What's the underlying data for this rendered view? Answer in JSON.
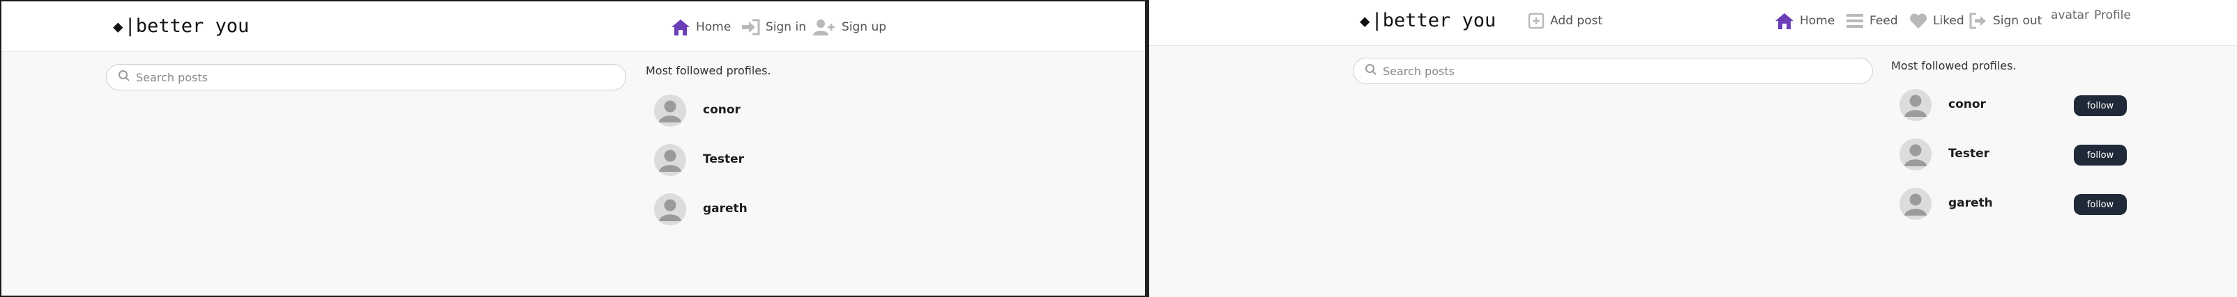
{
  "brand": {
    "symbol": "◆",
    "name": "|better you"
  },
  "left_pane": {
    "nav": {
      "home": "Home",
      "sign_in": "Sign in",
      "sign_up": "Sign up"
    },
    "search": {
      "placeholder": "Search posts"
    },
    "section_title": "Most followed profiles.",
    "profiles": [
      {
        "name": "conor"
      },
      {
        "name": "Tester"
      },
      {
        "name": "gareth"
      }
    ]
  },
  "right_pane": {
    "nav": {
      "add_post": "Add post",
      "home": "Home",
      "feed": "Feed",
      "liked": "Liked",
      "sign_out": "Sign out",
      "avatar_alt": "avatar",
      "profile": "Profile"
    },
    "search": {
      "placeholder": "Search posts"
    },
    "section_title": "Most followed profiles.",
    "profiles": [
      {
        "name": "conor",
        "follow_label": "follow"
      },
      {
        "name": "Tester",
        "follow_label": "follow"
      },
      {
        "name": "gareth",
        "follow_label": "follow"
      }
    ]
  },
  "colors": {
    "accent": "#6b3fb8",
    "nav_icon": "#b9b9b9",
    "button_bg": "#1f2937",
    "background": "#f8f8f8"
  }
}
